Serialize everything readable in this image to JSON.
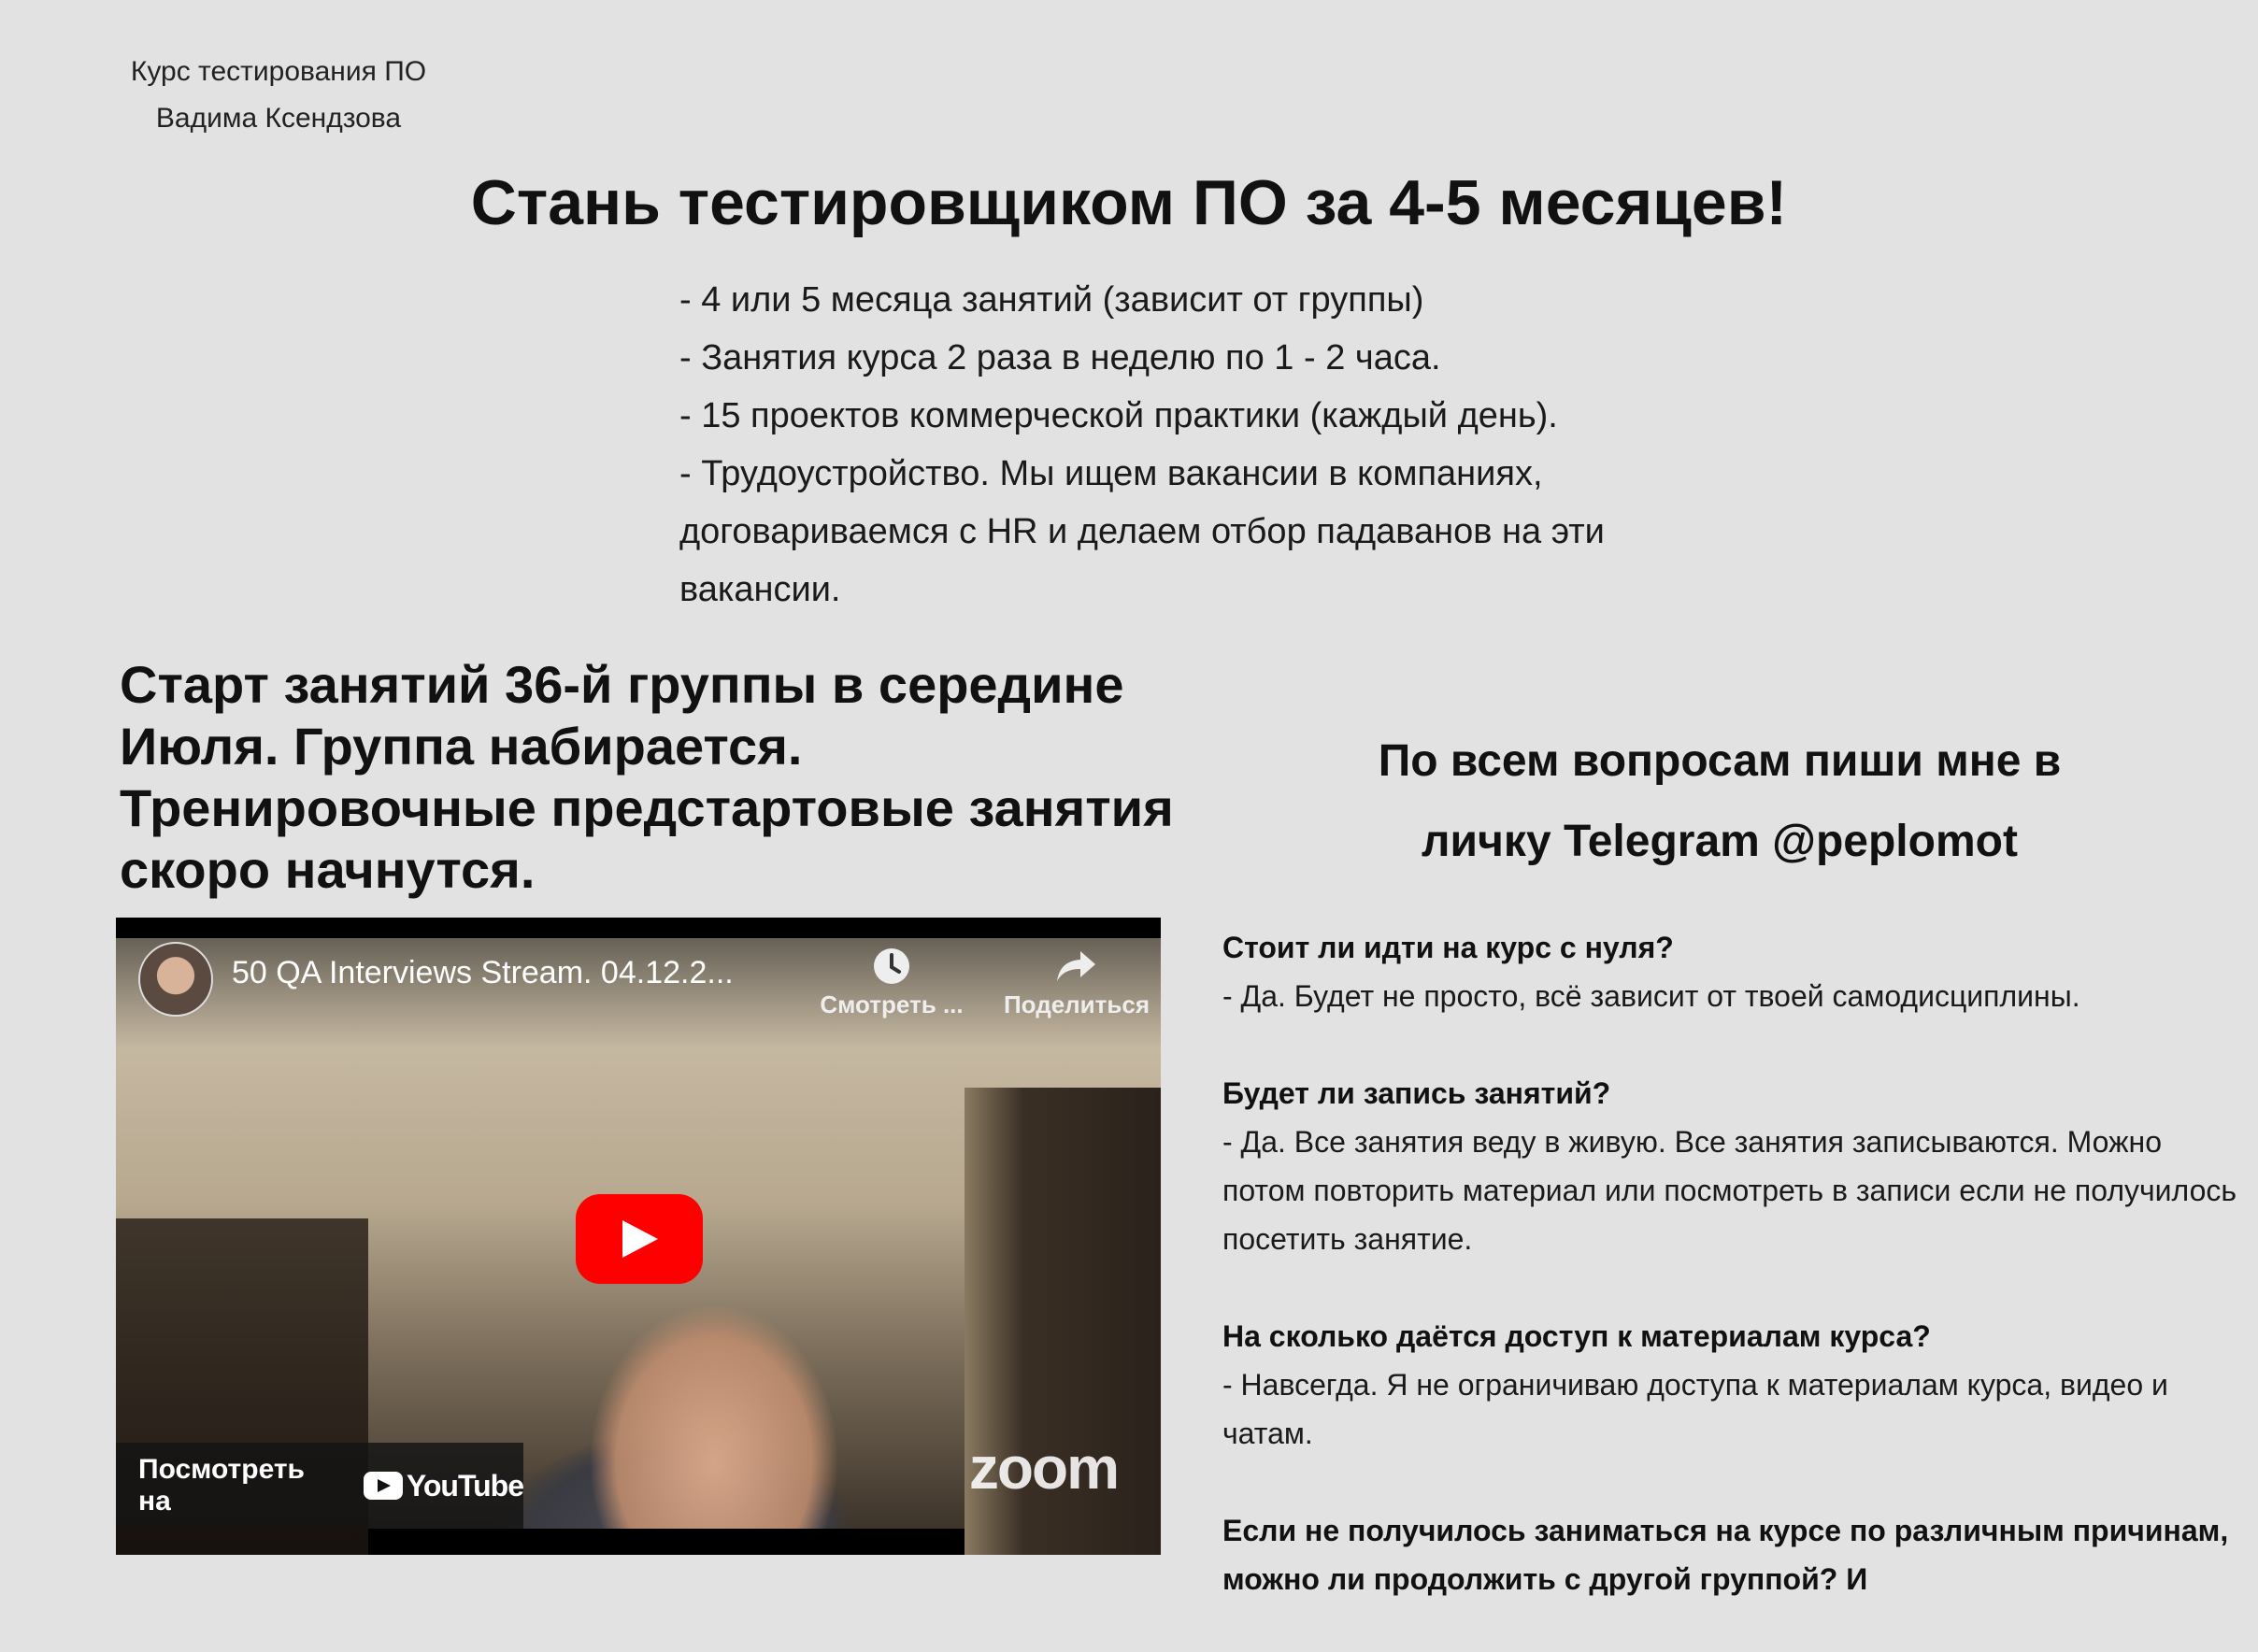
{
  "logo": {
    "line1": "Курс тестирования ПО",
    "line2": "Вадима Ксендзова"
  },
  "hero": {
    "title": "Стань тестировщиком ПО за 4-5 месяцев!",
    "features": [
      "- 4 или 5 месяца занятий (зависит от группы)",
      "- Занятия курса 2 раза в неделю по 1 - 2 часа.",
      "- 15 проектов коммерческой практики (каждый день).",
      "- Трудоустройство. Мы ищем вакансии в компаниях,",
      "договариваемся с HR и делаем отбор падаванов на эти",
      "вакансии."
    ]
  },
  "start": {
    "heading": "Старт занятий 36-й группы в середине Июля. Группа набирается. Тренировочные предстартовые занятия скоро начнутся."
  },
  "video": {
    "title": "50 QA Interviews Stream. 04.12.2...",
    "watch_later_label": "Смотреть ...",
    "share_label": "Поделиться",
    "watch_on_label": "Посмотреть на",
    "youtube_word": "YouTube",
    "zoom_word": "zoom",
    "play_color": "#ff0000"
  },
  "contact": {
    "line1": "По всем вопросам пиши мне в",
    "line2": "личку Telegram @peplomot"
  },
  "faq": [
    {
      "q": "Стоит ли идти на курс с нуля?",
      "a": "- Да. Будет не просто, всё зависит от твоей самодисциплины."
    },
    {
      "q": "Будет ли запись занятий?",
      "a": "- Да. Все занятия веду в живую. Все занятия записываются. Можно потом повторить материал или посмотреть в записи если не получилось посетить занятие."
    },
    {
      "q": "На сколько даётся доступ к материалам курса?",
      "a": "- Навсегда. Я не ограничиваю доступа к материалам курса, видео и чатам."
    },
    {
      "q": "Если не получилось заниматься на курсе по различным причинам, можно ли продолжить с другой группой? И",
      "a": ""
    }
  ]
}
